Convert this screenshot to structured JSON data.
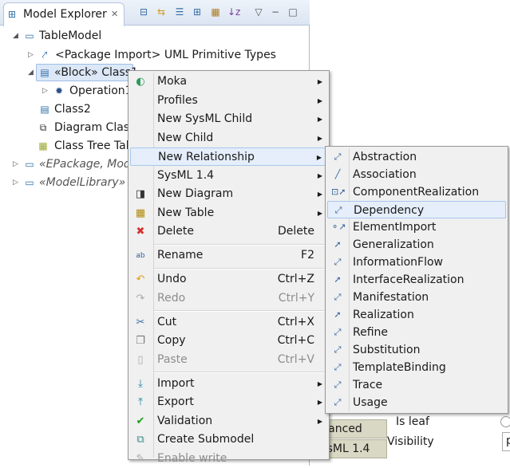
{
  "explorer": {
    "title": "Model Explorer",
    "toolbar": [
      "collapse-all-icon",
      "link-editor-icon",
      "list-icon",
      "tree-icon",
      "customize-icon",
      "sort-az-icon",
      "view-menu-icon",
      "minimize-icon",
      "maximize-icon"
    ],
    "tree": [
      {
        "label": "TableModel",
        "icon": "package-icon",
        "expanded": true
      },
      {
        "label": "<Package Import> UML Primitive Types",
        "icon": "package-import-icon"
      },
      {
        "label": "«Block» Class1",
        "icon": "class-icon",
        "selected": true,
        "expanded": true
      },
      {
        "label": "Operation1",
        "icon": "operation-icon"
      },
      {
        "label": "Class2",
        "icon": "class-icon"
      },
      {
        "label": "Diagram Class",
        "icon": "diagram-icon"
      },
      {
        "label": "Class Tree Tab",
        "icon": "table-icon"
      },
      {
        "label": "«EPackage, Mode",
        "icon": "epackage-icon"
      },
      {
        "label": "«ModelLibrary» E",
        "icon": "model-library-icon"
      }
    ]
  },
  "properties": {
    "tabs": [
      "dvanced",
      "sysML 1.4"
    ],
    "fields": [
      "Is leaf",
      "Visibility"
    ],
    "visibility_value": "p"
  },
  "context_menu": {
    "items": [
      {
        "label": "Moka",
        "icon": "moka-icon",
        "submenu": true
      },
      {
        "label": "Profiles",
        "submenu": true
      },
      {
        "label": "New SysML Child",
        "submenu": true
      },
      {
        "label": "New Child",
        "submenu": true
      },
      {
        "label": "New Relationship",
        "submenu": true,
        "highlighted": true
      },
      {
        "label": "SysML 1.4",
        "submenu": true
      },
      {
        "label": "New Diagram",
        "icon": "new-diagram-icon",
        "submenu": true
      },
      {
        "label": "New Table",
        "icon": "new-table-icon",
        "submenu": true
      },
      {
        "label": "Delete",
        "icon": "delete-icon",
        "shortcut": "Delete"
      },
      {
        "label": "Rename",
        "icon": "rename-icon",
        "shortcut": "F2"
      },
      {
        "label": "Undo",
        "icon": "undo-icon",
        "shortcut": "Ctrl+Z"
      },
      {
        "label": "Redo",
        "icon": "redo-icon",
        "shortcut": "Ctrl+Y",
        "disabled": true
      },
      {
        "label": "Cut",
        "icon": "cut-icon",
        "shortcut": "Ctrl+X"
      },
      {
        "label": "Copy",
        "icon": "copy-icon",
        "shortcut": "Ctrl+C"
      },
      {
        "label": "Paste",
        "icon": "paste-icon",
        "shortcut": "Ctrl+V",
        "disabled": true
      },
      {
        "label": "Import",
        "icon": "import-icon",
        "submenu": true
      },
      {
        "label": "Export",
        "icon": "export-icon",
        "submenu": true
      },
      {
        "label": "Validation",
        "icon": "validation-icon",
        "submenu": true
      },
      {
        "label": "Create Submodel",
        "icon": "submodel-icon"
      },
      {
        "label": "Enable write",
        "icon": "enable-write-icon",
        "disabled": true
      }
    ]
  },
  "relationship_menu": {
    "items": [
      "Abstraction",
      "Association",
      "ComponentRealization",
      "Dependency",
      "ElementImport",
      "Generalization",
      "InformationFlow",
      "InterfaceRealization",
      "Manifestation",
      "Realization",
      "Refine",
      "Substitution",
      "TemplateBinding",
      "Trace",
      "Usage"
    ],
    "highlighted": "Dependency"
  }
}
